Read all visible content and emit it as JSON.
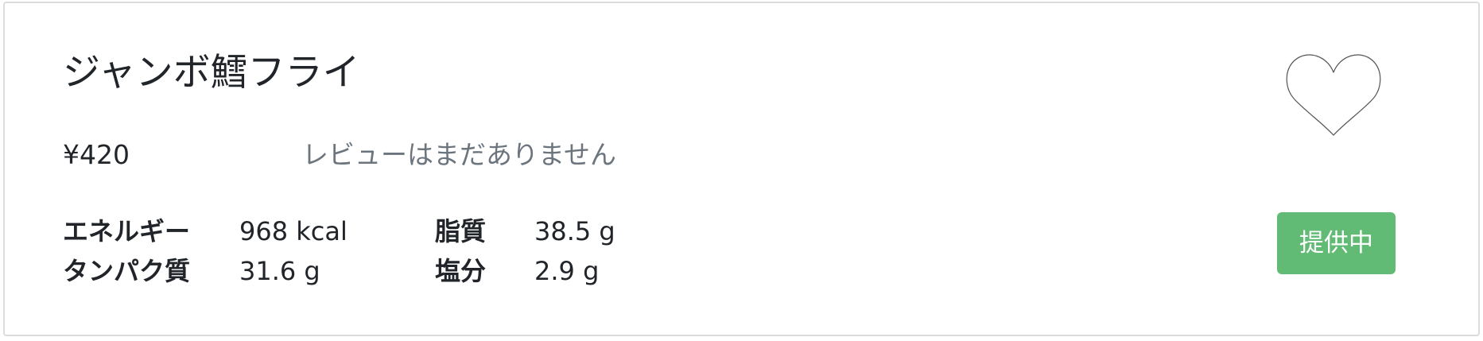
{
  "product": {
    "name": "ジャンボ鱈フライ",
    "price": "¥420",
    "review_text": "レビューはまだありません",
    "status": "提供中",
    "favorite_icon": "heart-outline-icon"
  },
  "nutrition": {
    "energy": {
      "label": "エネルギー",
      "value": "968 kcal"
    },
    "fat": {
      "label": "脂質",
      "value": "38.5 g"
    },
    "protein": {
      "label": "タンパク質",
      "value": "31.6 g"
    },
    "salt": {
      "label": "塩分",
      "value": "2.9 g"
    }
  },
  "colors": {
    "status_badge": "#62bb74",
    "muted_text": "#6c757d",
    "border": "#dcdcdc"
  }
}
